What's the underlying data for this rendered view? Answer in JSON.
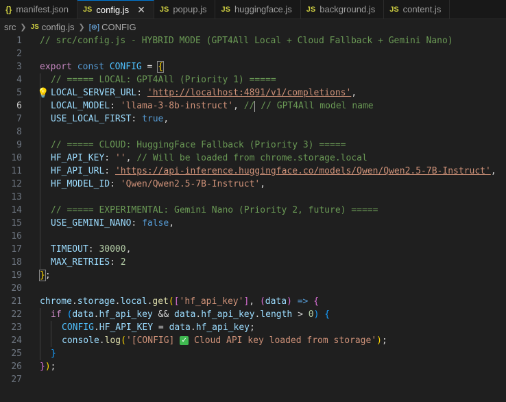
{
  "tabs": [
    {
      "icon": "{}",
      "label": "manifest.json",
      "active": false
    },
    {
      "icon": "JS",
      "label": "config.js",
      "active": true
    },
    {
      "icon": "JS",
      "label": "popup.js",
      "active": false
    },
    {
      "icon": "JS",
      "label": "huggingface.js",
      "active": false
    },
    {
      "icon": "JS",
      "label": "background.js",
      "active": false
    },
    {
      "icon": "JS",
      "label": "content.js",
      "active": false
    }
  ],
  "breadcrumb": {
    "folder": "src",
    "file": "config.js",
    "symbol": "CONFIG"
  },
  "editor": {
    "current_line": 6,
    "lines": [
      {
        "n": "1"
      },
      {
        "n": "2"
      },
      {
        "n": "3"
      },
      {
        "n": "4"
      },
      {
        "n": "5"
      },
      {
        "n": "6"
      },
      {
        "n": "7"
      },
      {
        "n": "8"
      },
      {
        "n": "9"
      },
      {
        "n": "10"
      },
      {
        "n": "11"
      },
      {
        "n": "12"
      },
      {
        "n": "13"
      },
      {
        "n": "14"
      },
      {
        "n": "15"
      },
      {
        "n": "16"
      },
      {
        "n": "17"
      },
      {
        "n": "18"
      },
      {
        "n": "19"
      },
      {
        "n": "20"
      },
      {
        "n": "21"
      },
      {
        "n": "22"
      },
      {
        "n": "23"
      },
      {
        "n": "24"
      },
      {
        "n": "25"
      },
      {
        "n": "26"
      },
      {
        "n": "27"
      }
    ],
    "tokens": {
      "l1": "// src/config.js - HYBRID MODE (GPT4All Local + Cloud Fallback + Gemini Nano)",
      "export": "export",
      "const": "const",
      "config": "CONFIG",
      "eq": " = ",
      "l4": "// ===== LOCAL: GPT4All (Priority 1) =====",
      "local_server_url": "LOCAL_SERVER_URL",
      "local_server_url_val": "'http://localhost:4891/v1/completions'",
      "local_model": "LOCAL_MODEL",
      "local_model_val": "'llama-3-8b-instruct'",
      "l6_comment_a": "//",
      "l6_comment_b": " // GPT4All model name",
      "use_local_first": "USE_LOCAL_FIRST",
      "true": "true",
      "l9": "// ===== CLOUD: HuggingFace Fallback (Priority 3) =====",
      "hf_api_key": "HF_API_KEY",
      "hf_api_key_val": "''",
      "l10_comment": "// Will be loaded from chrome.storage.local",
      "hf_api_url": "HF_API_URL",
      "hf_api_url_val": "'https://api-inference.huggingface.co/models/Qwen/Qwen2.5-7B-Instruct'",
      "hf_model_id": "HF_MODEL_ID",
      "hf_model_id_val": "'Qwen/Qwen2.5-7B-Instruct'",
      "l14": "// ===== EXPERIMENTAL: Gemini Nano (Priority 2, future) =====",
      "use_gemini_nano": "USE_GEMINI_NANO",
      "false": "false",
      "timeout": "TIMEOUT",
      "timeout_val": "30000",
      "max_retries": "MAX_RETRIES",
      "max_retries_val": "2",
      "chrome": "chrome",
      "storage": "storage",
      "local": "local",
      "get": "get",
      "hf_api_key_str": "'hf_api_key'",
      "data": "data",
      "arrow": "=>",
      "if": "if",
      "hf_api_key_prop": "hf_api_key",
      "length": "length",
      "zero": "0",
      "console": "console",
      "log": "log",
      "log_str_a": "'[CONFIG] ",
      "log_str_b": " Cloud API key loaded from storage'"
    }
  }
}
